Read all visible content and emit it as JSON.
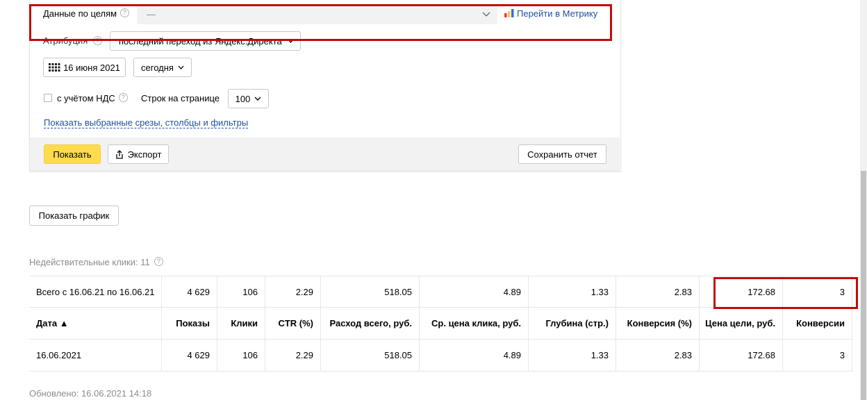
{
  "filters": {
    "goals_label": "Данные по целям",
    "goals_value": "—",
    "metrika_link": "Перейти в Метрику",
    "attribution_label": "Атрибуция",
    "attribution_value": "последний переход из Яндекс.Директа",
    "date_value": "16 июня 2021",
    "period_value": "сегодня",
    "vat_label": "с учётом НДС",
    "rows_label": "Строк на странице",
    "rows_value": "100",
    "show_selected_link": "Показать выбранные срезы, столбцы и фильтры"
  },
  "actions": {
    "show_label": "Показать",
    "export_label": "Экспорт",
    "save_report_label": "Сохранить отчет",
    "show_chart_label": "Показать график"
  },
  "invalid_clicks": "Недействительные клики: 11",
  "table": {
    "total_row": [
      "Всего с 16.06.21 по 16.06.21",
      "4 629",
      "106",
      "2.29",
      "518.05",
      "4.89",
      "1.33",
      "2.83",
      "172.68",
      "3"
    ],
    "headers": [
      "Дата ▲",
      "Показы",
      "Клики",
      "CTR (%)",
      "Расход всего, руб.",
      "Ср. цена клика, руб.",
      "Глубина (стр.)",
      "Конверсия (%)",
      "Цена цели, руб.",
      "Конверсии"
    ],
    "rows": [
      [
        "16.06.2021",
        "4 629",
        "106",
        "2.29",
        "518.05",
        "4.89",
        "1.33",
        "2.83",
        "172.68",
        "3"
      ]
    ]
  },
  "updated": "Обновлено: 16.06.2021 14:18",
  "colors": {
    "accent_yellow": "#ffdb4d",
    "link_blue": "#1f4f9e",
    "highlight_red": "#c40a0a"
  }
}
